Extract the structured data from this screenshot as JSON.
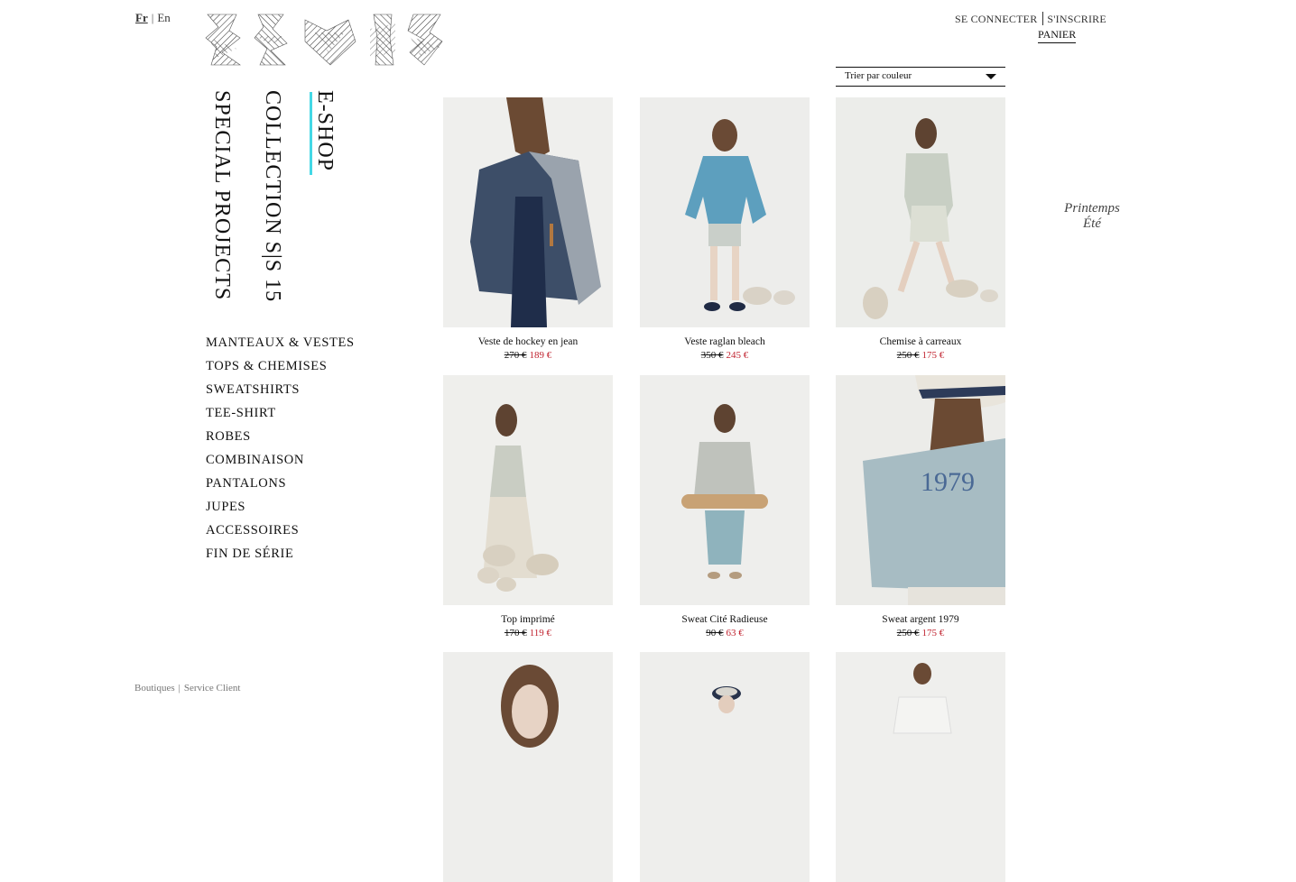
{
  "language": {
    "active": "Fr",
    "other": "En"
  },
  "account": {
    "login": "SE CONNECTER",
    "register": "S'INSCRIRE",
    "cart": "PANIER"
  },
  "nav": {
    "eshop": "E-SHOP",
    "collection": "COLLECTION S|S 15",
    "special": "SPECIAL PROJECTS"
  },
  "accent_color": "#43d8e6",
  "sale_color": "#c0232f",
  "categories": [
    "MANTEAUX & VESTES",
    "TOPS & CHEMISES",
    "SWEATSHIRTS",
    "TEE-SHIRT",
    "ROBES",
    "COMBINAISON",
    "PANTALONS",
    "JUPES",
    "ACCESSOIRES",
    "FIN DE SÉRIE"
  ],
  "sort": {
    "label": "Trier par couleur"
  },
  "season": {
    "line1": "Printemps",
    "line2": "Été"
  },
  "footer": {
    "shops": "Boutiques",
    "service": "Service Client"
  },
  "products": [
    {
      "name": "Veste de hockey en jean",
      "old_price": "270 €",
      "new_price": "189 €"
    },
    {
      "name": "Veste raglan bleach",
      "old_price": "350 €",
      "new_price": "245 €"
    },
    {
      "name": "Chemise à carreaux",
      "old_price": "250 €",
      "new_price": "175 €"
    },
    {
      "name": "Top imprimé",
      "old_price": "170 €",
      "new_price": "119 €"
    },
    {
      "name": "Sweat Cité Radieuse",
      "old_price": "90 €",
      "new_price": "63 €"
    },
    {
      "name": "Sweat argent 1979",
      "old_price": "250 €",
      "new_price": "175 €"
    },
    {
      "name": "",
      "old_price": "",
      "new_price": ""
    },
    {
      "name": "",
      "old_price": "",
      "new_price": ""
    },
    {
      "name": "",
      "old_price": "",
      "new_price": ""
    }
  ],
  "sweat_print": "1979"
}
